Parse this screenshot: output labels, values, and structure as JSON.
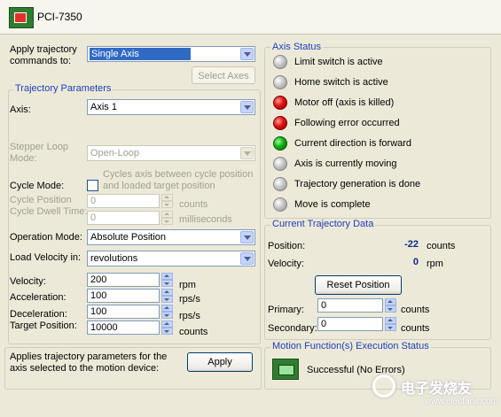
{
  "window": {
    "title": "PCI-7350",
    "icon": "pci-board-icon"
  },
  "left": {
    "apply_label": "Apply trajectory\ncommands to:",
    "apply_value": "Single Axis",
    "select_axes_label": "Select Axes",
    "traj_group_title": "Trajectory Parameters",
    "axis_label": "Axis:",
    "axis_value": "Axis 1",
    "stepper_label": "Stepper Loop\nMode:",
    "stepper_value": "Open-Loop",
    "cycle_desc": "Cycles axis between cycle position\nand loaded target position",
    "cycle_mode_label": "Cycle Mode:",
    "cycle_position_label": "Cycle Position",
    "cycle_position_value": "0",
    "cycle_position_unit": "counts",
    "cycle_dwell_label": "Cycle Dwell Time:",
    "cycle_dwell_value": "0",
    "cycle_dwell_unit": "milliseconds",
    "operation_mode_label": "Operation Mode:",
    "operation_mode_value": "Absolute Position",
    "load_velocity_label": "Load Velocity in:",
    "load_velocity_value": "revolutions",
    "velocity_label": "Velocity:",
    "velocity_value": "200",
    "velocity_unit": "rpm",
    "acceleration_label": "Acceleration:",
    "acceleration_value": "100",
    "acceleration_unit": "rps/s",
    "deceleration_label": "Deceleration:",
    "deceleration_value": "100",
    "deceleration_unit": "rps/s",
    "target_label": "Target Position:",
    "target_value": "10000",
    "target_unit": "counts",
    "apply_desc": "Applies trajectory parameters for the\naxis selected to the motion device:",
    "apply_button": "Apply"
  },
  "axis_status": {
    "title": "Axis Status",
    "items": [
      {
        "label": "Limit switch is active",
        "state": "off"
      },
      {
        "label": "Home switch is active",
        "state": "off"
      },
      {
        "label": "Motor off (axis is killed)",
        "state": "red"
      },
      {
        "label": "Following error occurred",
        "state": "red"
      },
      {
        "label": "Current direction is forward",
        "state": "green"
      },
      {
        "label": "Axis is currently moving",
        "state": "off"
      },
      {
        "label": "Trajectory generation is done",
        "state": "off"
      },
      {
        "label": "Move is complete",
        "state": "off"
      }
    ]
  },
  "traj_data": {
    "title": "Current Trajectory Data",
    "position_label": "Position:",
    "position_value": "-22",
    "position_unit": "counts",
    "velocity_label": "Velocity:",
    "velocity_value": "0",
    "velocity_unit": "rpm",
    "reset_button": "Reset Position",
    "primary_label": "Primary:",
    "primary_value": "0",
    "primary_unit": "counts",
    "secondary_label": "Secondary:",
    "secondary_value": "0",
    "secondary_unit": "counts"
  },
  "motion_status": {
    "title": "Motion Function(s) Execution Status",
    "value": "Successful (No Errors)"
  },
  "watermark": {
    "text": "电子发烧友",
    "url": "www.elecfans.com"
  },
  "colors": {
    "group_title": "#1d3fb8",
    "selection": "#316ac5",
    "background": "#ece9d8"
  }
}
